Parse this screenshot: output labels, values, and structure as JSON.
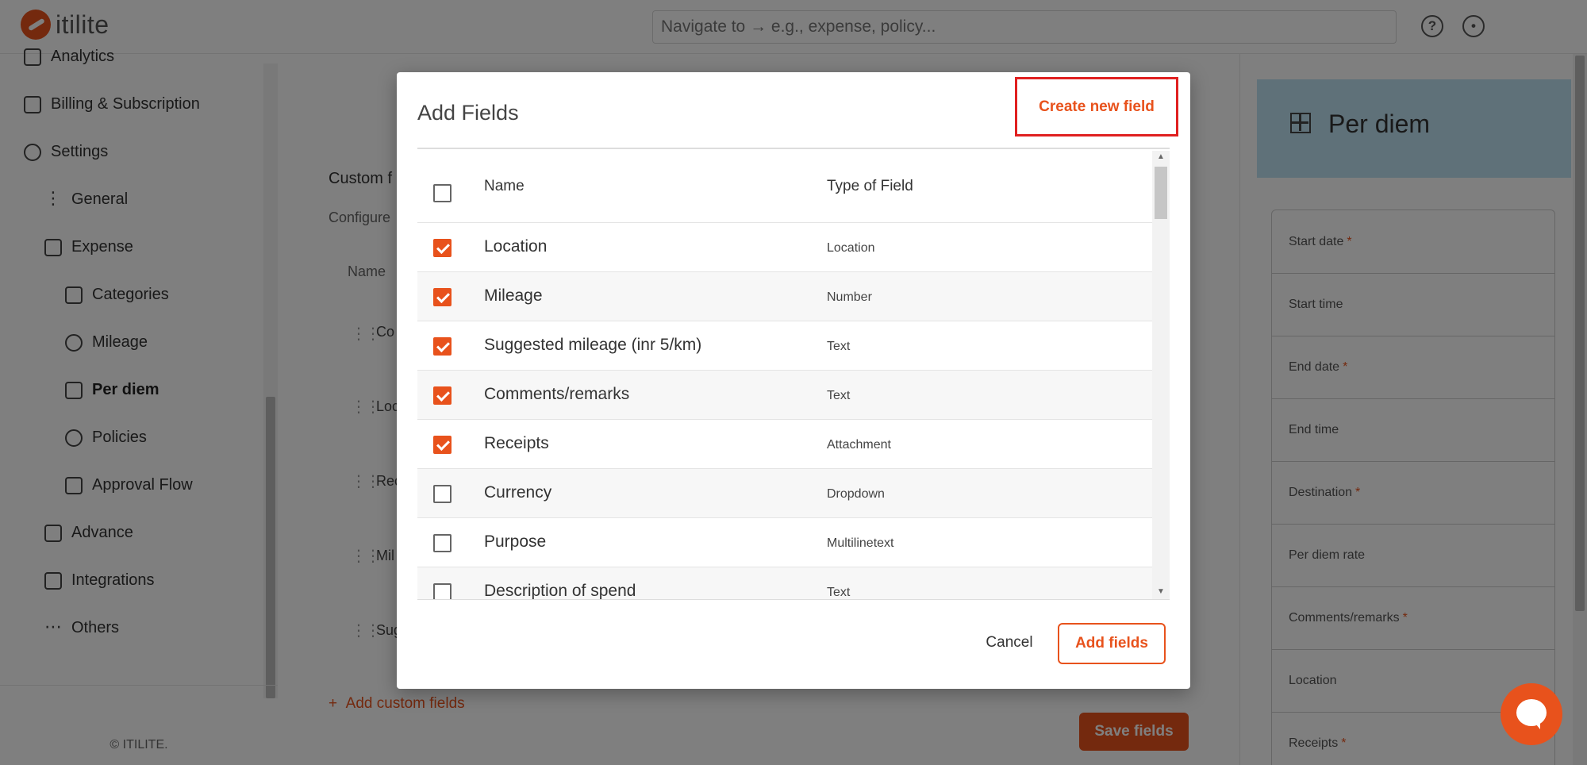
{
  "app": {
    "logo_text": "itilite",
    "search_placeholder": "Navigate to → e.g., expense, policy..."
  },
  "topbar": {
    "help_icon": "help-circle-icon",
    "profile_icon": "user-circle-icon"
  },
  "sidebar": {
    "items": [
      {
        "label": "Analytics",
        "icon": "analytics-icon"
      },
      {
        "label": "Billing & Subscription",
        "icon": "billing-icon"
      },
      {
        "label": "Settings",
        "icon": "gear-icon"
      },
      {
        "label": "General",
        "icon": "vertical-dots-icon"
      },
      {
        "label": "Expense",
        "icon": "receipt-icon"
      },
      {
        "label": "Categories",
        "icon": "categories-icon"
      },
      {
        "label": "Mileage",
        "icon": "speedometer-icon"
      },
      {
        "label": "Per diem",
        "icon": "calendar-icon"
      },
      {
        "label": "Policies",
        "icon": "check-circle-icon"
      },
      {
        "label": "Approval Flow",
        "icon": "clipboard-check-icon"
      },
      {
        "label": "Advance",
        "icon": "advance-icon"
      },
      {
        "label": "Integrations",
        "icon": "integrations-icon"
      },
      {
        "label": "Others",
        "icon": "horizontal-dots-icon"
      }
    ],
    "footer": "© ITILITE."
  },
  "main": {
    "section_title": "Custom f",
    "section_desc": "Configure",
    "table_header_name": "Name",
    "rows": [
      "Co",
      "Loc",
      "Rec",
      "Mil",
      "Sug"
    ],
    "add_custom_label": "Add custom fields",
    "save_label": "Save fields"
  },
  "preview": {
    "title": "Per diem",
    "fields": [
      {
        "label": "Start date",
        "required": "*"
      },
      {
        "label": "Start time",
        "required": ""
      },
      {
        "label": "End date",
        "required": "*"
      },
      {
        "label": "End time",
        "required": ""
      },
      {
        "label": "Destination",
        "required": "*"
      },
      {
        "label": "Per diem rate",
        "required": ""
      },
      {
        "label": "Comments/remarks",
        "required": "*"
      },
      {
        "label": "Location",
        "required": ""
      },
      {
        "label": "Receipts",
        "required": "*"
      }
    ]
  },
  "modal": {
    "title": "Add Fields",
    "create_label": "Create new field",
    "columns": {
      "name": "Name",
      "type": "Type of Field"
    },
    "rows": [
      {
        "name": "Location",
        "type": "Location",
        "checked": true
      },
      {
        "name": "Mileage",
        "type": "Number",
        "checked": true
      },
      {
        "name": "Suggested mileage (inr 5/km)",
        "type": "Text",
        "checked": true
      },
      {
        "name": "Comments/remarks",
        "type": "Text",
        "checked": true
      },
      {
        "name": "Receipts",
        "type": "Attachment",
        "checked": true
      },
      {
        "name": "Currency",
        "type": "Dropdown",
        "checked": false
      },
      {
        "name": "Purpose",
        "type": "Multilinetext",
        "checked": false
      },
      {
        "name": "Description of spend",
        "type": "Text",
        "checked": false
      }
    ],
    "cancel_label": "Cancel",
    "add_label": "Add fields"
  },
  "colors": {
    "accent": "#e8521c",
    "highlight": "#e02020",
    "preview_header": "#bfe3f2"
  }
}
